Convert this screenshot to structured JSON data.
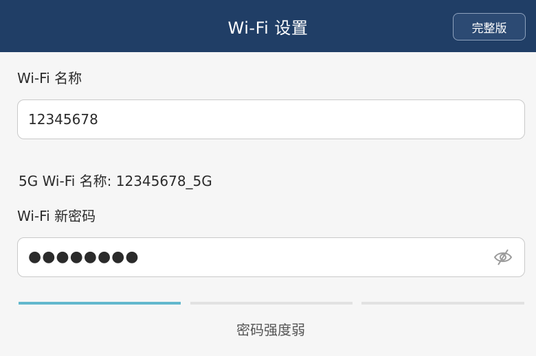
{
  "header": {
    "title": "Wi-Fi 设置",
    "full_version_label": "完整版"
  },
  "ssid": {
    "label": "Wi-Fi 名称",
    "value": "12345678"
  },
  "ssid_5g": {
    "text": "5G Wi-Fi 名称: 12345678_5G"
  },
  "password": {
    "label": "Wi-Fi 新密码",
    "masked_value": "●●●●●●●●",
    "toggle_icon": "eye-hidden-icon"
  },
  "strength": {
    "levels_filled": 1,
    "levels_total": 3,
    "text": "密码强度弱"
  },
  "colors": {
    "header_bg": "#203e66",
    "strength_active": "#62b8cd",
    "strength_inactive": "#e2e2e2"
  }
}
